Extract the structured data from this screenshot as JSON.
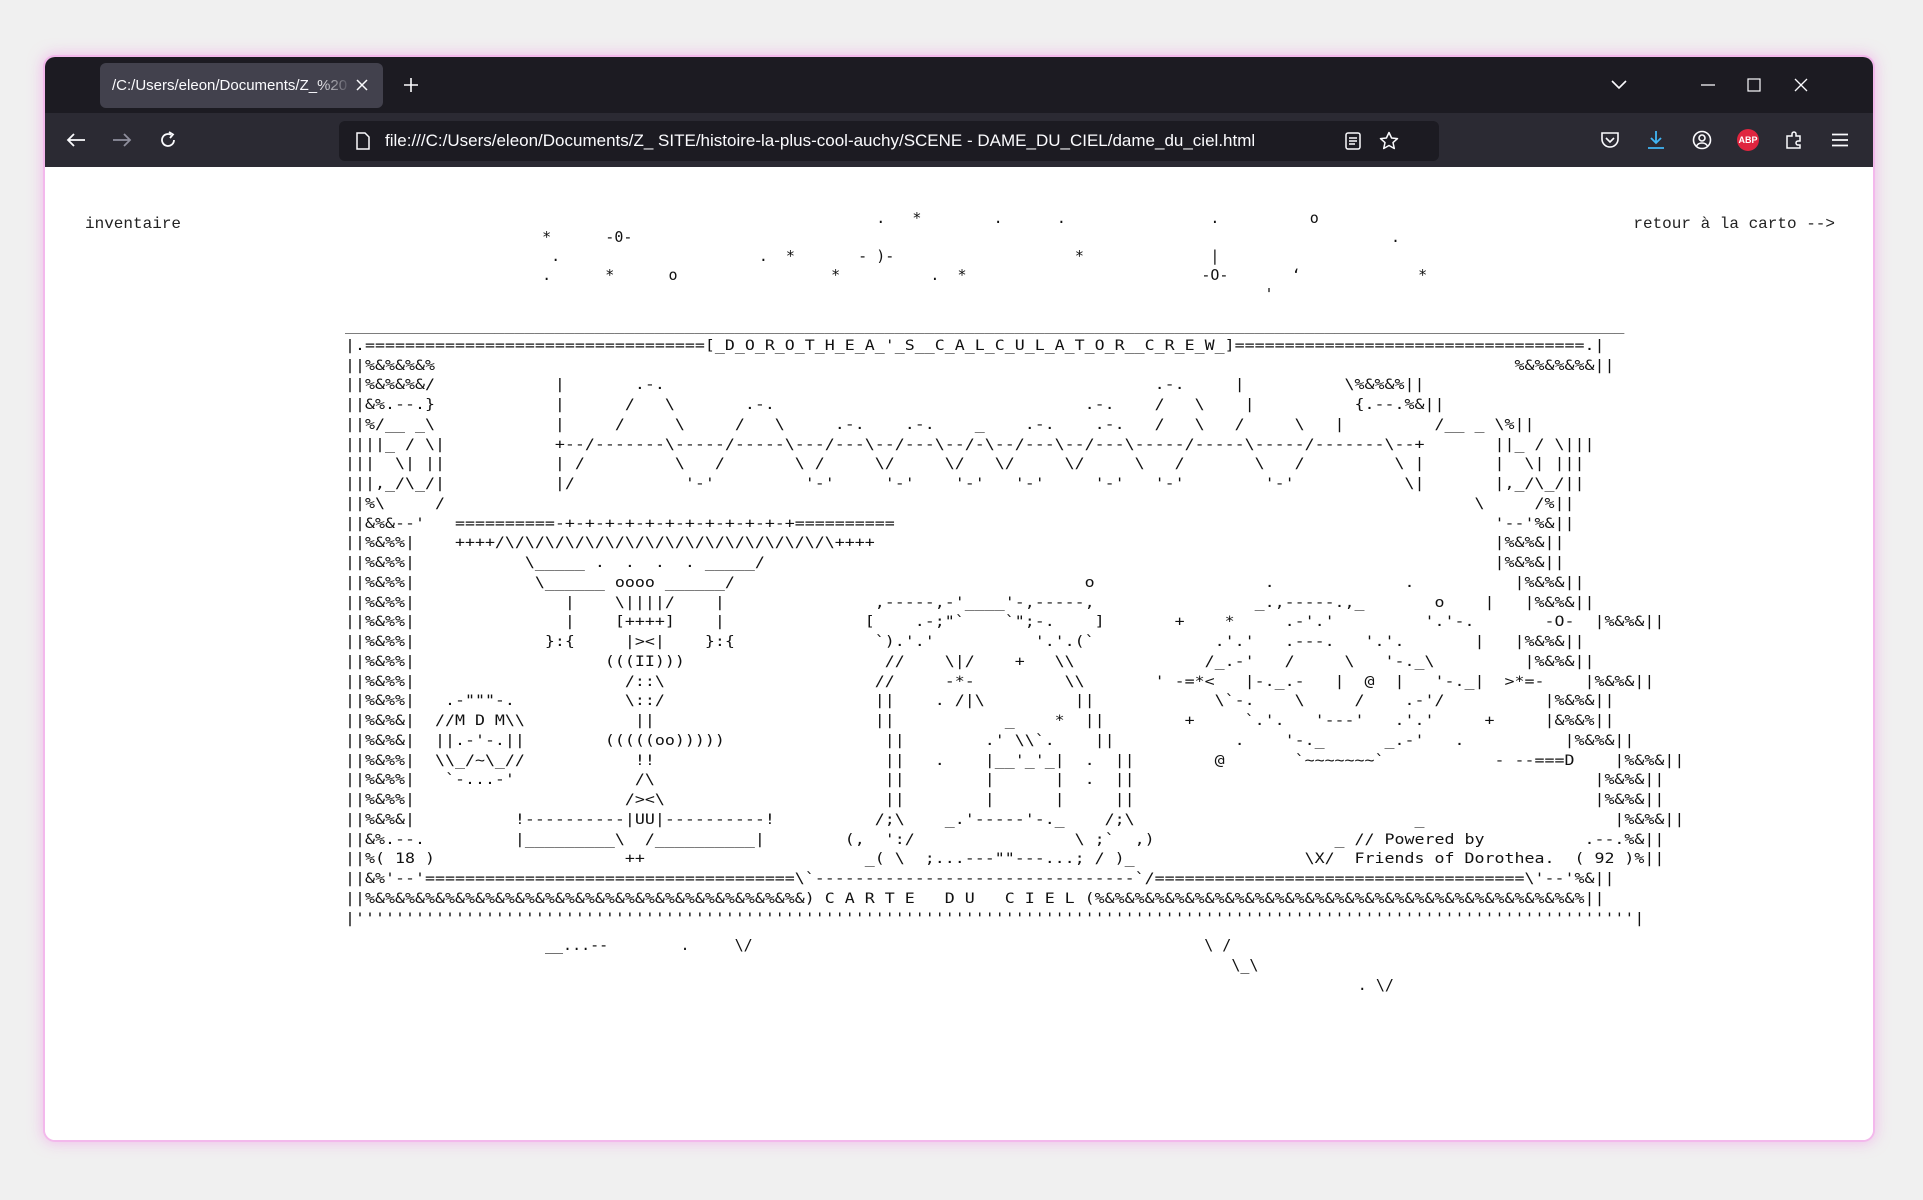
{
  "browser": {
    "tab_title": "/C:/Users/eleon/Documents/Z_%20",
    "url": "file:///C:/Users/eleon/Documents/Z_ SITE/histoire-la-plus-cool-auchy/SCENE - DAME_DU_CIEL/dame_du_ciel.html"
  },
  "page": {
    "left_link": "inventaire",
    "right_link": "retour à la carto -->",
    "sky_art": "                                        .   *        .      .                .          o\n   *      -0-                                                                                    .\n    .                      .  *       - )-                    *              |\n   .      *      o                 *          .  *                          -O-       ‘             *\n                                                                                   '",
    "main_art": "________________________________________________________________________________________________________________________________\n|.==================================[_D_O_R_O_T_H_E_A_'_S__C_A_L_C_U_L_A_T_O_R__C_R_E_W_]===================================.|\n||%&%&%&%                                                                                                            %&%&%&%&||\n||%&%&%&/            |       .-.                                                 .-.     |          \\%&%&%||\n||&%.--.}            |      /   \\       .-.                               .-.    /   \\    |          {.--.%&||\n||%/__ _\\            |     /     \\     /   \\     .-.    .-.    _    .-.    .-.   /   \\   /     \\   |         /__ _ \\%||\n||||_ / \\|           +--/-------\\-----/-----\\---/---\\--/---\\--/-\\--/---\\--/---\\-----/-----\\-----/-------\\--+       ||_ / \\|||\n|||  \\| ||           | /         \\   /       \\ /     \\/     \\/   \\/     \\/     \\   /       \\   /         \\ |       |  \\| |||\n|||,_/\\_/|           |/           '-'         '-'     '-'    '-'   '-'     '-'   '-'        '-'           \\|       |,_/\\_/||\n||%\\     /                                                                                                       \\     /%||\n||&%&--'   ==========-+-+-+-+-+-+-+-+-+-+-+-+==========                                                            '--'%&||\n||%&%%|    ++++/\\/\\/\\/\\/\\/\\/\\/\\/\\/\\/\\/\\/\\/\\/\\/\\/\\++++                                                              |%&%&||\n||%&%%|           \\_____ .  .  .  . _____/                                                                         |%&%&||\n||%&%%|            \\______ oooo ______/                                   o                 .             .          |%&%&||\n||%&%%|               |    \\||||/    |               ,-----,-'____'-,-----,                _.,-----.,_       o    |   |%&%&||\n||%&%%|               |    [++++]    |              [    .-;\"`    `\";-.    ]       +    *     .-'.'         '.'-.       -O-  |%&%&||\n||%&%%|             }:{     |><|    }:{              `).'.'          '.'.(`            .'.'   .---.   '.'.       |   |%&%&||\n||%&%%|                   (((II)))                    //    \\|/    +   \\\\             /_.-'   /     \\   '-._\\         |%&%&||\n||%&%%|                     /::\\                     //     -*-         \\\\       ' -=*<   |-._.-   |  @  |   '-._|  >*=-    |%&%&||\n||%&%%|   .-\"\"\"-.           \\::/                     ||    . /|\\         ||            \\`-.    \\     /    .-'/          |%&%&||\n||%&%&|  //M D M\\\\           ||                      ||           _    *  ||        +     `.'.   '---'   .'.'     +     |&%&%||\n||%&%&|  ||.-'-.||        (((((oo)))))                ||        .' \\\\`.    ||            .    '-._      _.-'   .          |%&%&||\n||%&%%|  \\\\_/~\\_//           !!                       ||   .    |__'_'_|  .  ||        @       `~~~~~~~`           - --===D    |%&%&||\n||%&%%|   `-...-'            /\\                       ||        |      |  .  ||                                              |%&%&||\n||%&%%|                     /><\\                      ||        |      |     ||                                              |%&%&||\n||%&%&|          !----------|UU|----------!          /;\\    _.'-----'-._    /;\\                            _                   |%&%&||\n||&%.--.         |_________\\  /__________|        (,  ':/                \\ ;`  ,)                  _ // Powered by          .--.%&||\n||%( 18 )                   ++                      _( \\  ;...---\"\"---...; / )_                 \\X/  Friends of Dorothea.  ( 92 )%||\n||&%'--'=====================================\\`--------------------------------`/=====================================\\'--'%&||\n||%&%&%&%&%&%&%&%&%&%&%&%&%&%&%&%&%&%&%&%&%&%&) C A R T E   D U   C I E L (%&%&%&%&%&%&%&%&%&%&%&%&%&%&%&%&%&%&%&%&%&%&%&%&%||\n|''''''''''''''''''''''''''''''''''''''''''''''''''''''''''''''''''''''''''''''''''''''''''''''''''''''''''''''''''''''''''''''''|",
    "bottom_art": "__...--        .     \\/                                                  \\ /\n                                                                            \\_\\\n                                                                                          . \\/"
  }
}
